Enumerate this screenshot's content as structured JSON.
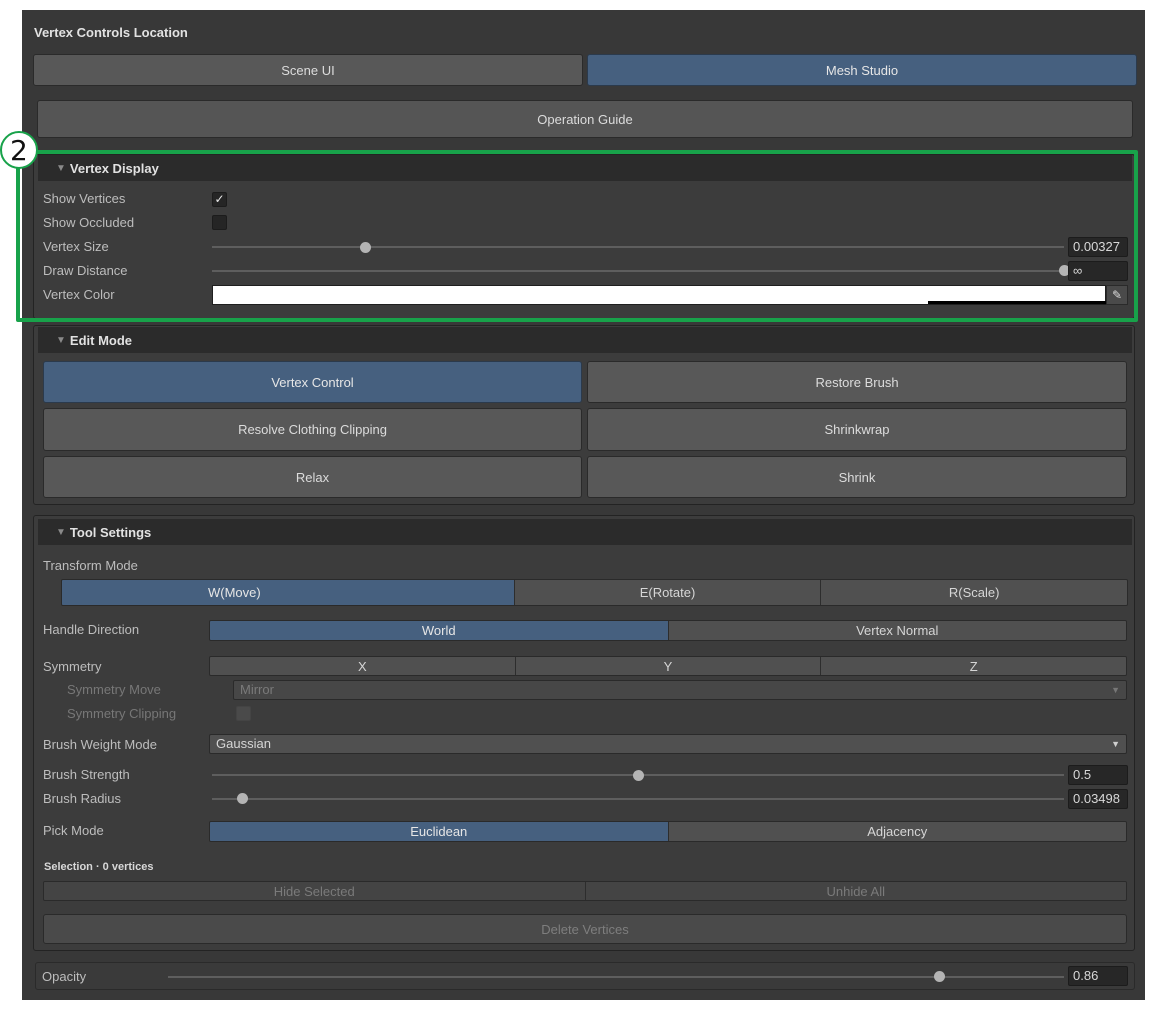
{
  "header": {
    "title": "Vertex Controls Location"
  },
  "location_tabs": [
    {
      "label": "Scene UI",
      "active": false
    },
    {
      "label": "Mesh Studio",
      "active": true
    }
  ],
  "operation_guide": "Operation Guide",
  "annotation_number": "2",
  "vertex_display": {
    "title": "Vertex Display",
    "show_vertices": {
      "label": "Show Vertices",
      "checked": true
    },
    "show_occluded": {
      "label": "Show Occluded",
      "checked": false
    },
    "vertex_size": {
      "label": "Vertex Size",
      "value": "0.00327",
      "level": 0.18
    },
    "draw_distance": {
      "label": "Draw Distance",
      "value": "∞",
      "level": 1.0
    },
    "vertex_color": {
      "label": "Vertex Color",
      "value": "#ffffff"
    }
  },
  "edit_mode": {
    "title": "Edit Mode",
    "buttons": [
      {
        "label": "Vertex Control",
        "active": true
      },
      {
        "label": "Restore Brush",
        "active": false
      },
      {
        "label": "Resolve Clothing Clipping",
        "active": false
      },
      {
        "label": "Shrinkwrap",
        "active": false
      },
      {
        "label": "Relax",
        "active": false
      },
      {
        "label": "Shrink",
        "active": false
      }
    ]
  },
  "tool_settings": {
    "title": "Tool Settings",
    "transform_mode_label": "Transform Mode",
    "transform_modes": [
      "W(Move)",
      "E(Rotate)",
      "R(Scale)"
    ],
    "transform_active": "W(Move)",
    "handle_direction": {
      "label": "Handle Direction",
      "options": [
        "World",
        "Vertex Normal"
      ],
      "active": "World"
    },
    "symmetry": {
      "label": "Symmetry",
      "options": [
        "X",
        "Y",
        "Z"
      ]
    },
    "symmetry_move": {
      "label": "Symmetry Move",
      "value": "Mirror"
    },
    "symmetry_clipping": {
      "label": "Symmetry Clipping",
      "checked": false
    },
    "brush_weight_mode": {
      "label": "Brush Weight Mode",
      "value": "Gaussian"
    },
    "brush_strength": {
      "label": "Brush Strength",
      "value": "0.5",
      "level": 0.5
    },
    "brush_radius": {
      "label": "Brush Radius",
      "value": "0.03498",
      "level": 0.035
    },
    "pick_mode": {
      "label": "Pick Mode",
      "options": [
        "Euclidean",
        "Adjacency"
      ],
      "active": "Euclidean"
    },
    "selection_label": "Selection · 0 vertices",
    "hide_selected": "Hide Selected",
    "unhide_all": "Unhide All",
    "delete_vertices": "Delete Vertices"
  },
  "opacity": {
    "label": "Opacity",
    "value": "0.86",
    "level": 0.86
  },
  "colors": {
    "accent": "#46607f",
    "highlight": "#18a24a",
    "background": "#383838"
  },
  "icons": {
    "triangle": "disclosure-triangle-icon",
    "check": "checkmark-icon",
    "dropdown": "dropdown-arrow-icon",
    "picker": "eyedropper-icon"
  }
}
